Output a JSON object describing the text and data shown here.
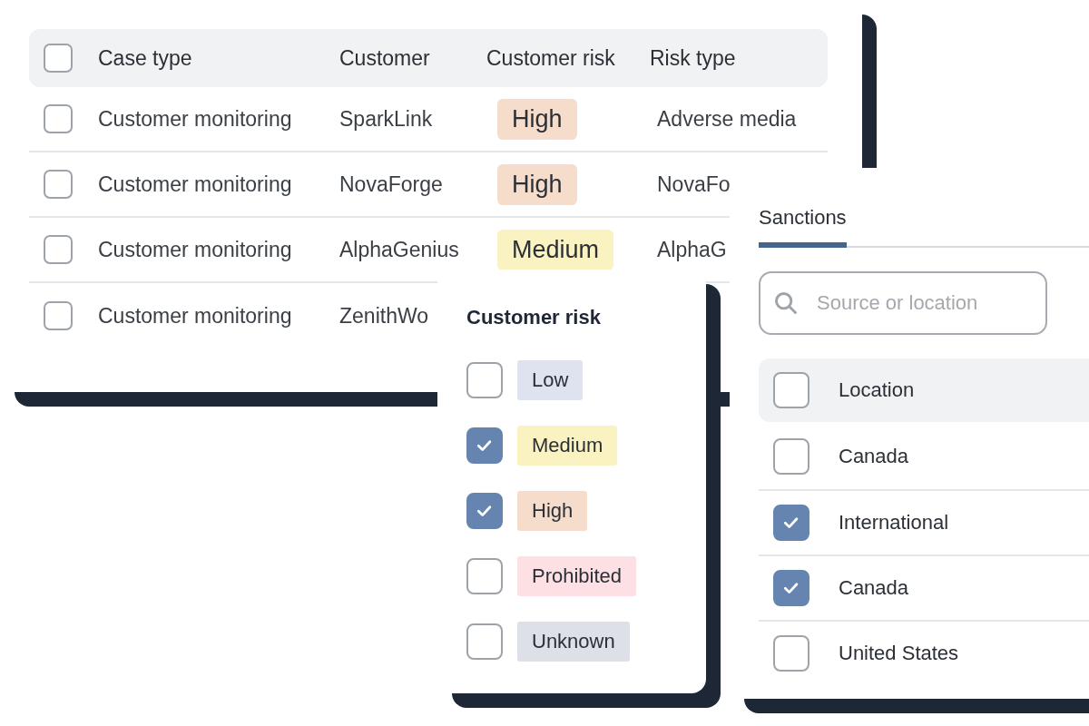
{
  "table": {
    "select_all_checked": false,
    "columns": [
      {
        "label": "Case type"
      },
      {
        "label": "Customer"
      },
      {
        "label": "Customer risk"
      },
      {
        "label": "Risk type"
      }
    ],
    "rows": [
      {
        "checked": false,
        "case_type": "Customer monitoring",
        "customer": "SparkLink",
        "risk": {
          "label": "High",
          "color": "#f6dccb"
        },
        "risk_type": "Adverse media"
      },
      {
        "checked": false,
        "case_type": "Customer monitoring",
        "customer": "NovaForge",
        "risk": {
          "label": "High",
          "color": "#f6dccb"
        },
        "risk_type": "NovaFo"
      },
      {
        "checked": false,
        "case_type": "Customer monitoring",
        "customer": "AlphaGenius",
        "risk": {
          "label": "Medium",
          "color": "#faf2c0"
        },
        "risk_type": "AlphaG"
      },
      {
        "checked": false,
        "case_type": "Customer monitoring",
        "customer": "ZenithWo"
      }
    ]
  },
  "risk_filter": {
    "title": "Customer risk",
    "options": [
      {
        "label": "Low",
        "checked": false,
        "color": "#dfe3ef"
      },
      {
        "label": "Medium",
        "checked": true,
        "color": "#faf2c0"
      },
      {
        "label": "High",
        "checked": true,
        "color": "#f6dccb"
      },
      {
        "label": "Prohibited",
        "checked": false,
        "color": "#fde0e4"
      },
      {
        "label": "Unknown",
        "checked": false,
        "color": "#dde0e6"
      }
    ]
  },
  "source_filter": {
    "tabs": [
      {
        "label": "Sanctions",
        "selected": true
      }
    ],
    "search": {
      "placeholder": "Source or location"
    },
    "header": {
      "label": "Location",
      "checked": false
    },
    "items": [
      {
        "label": "Canada",
        "checked": false
      },
      {
        "label": "International",
        "checked": true
      },
      {
        "label": "Canada",
        "checked": true
      },
      {
        "label": "United States",
        "checked": false
      }
    ]
  }
}
